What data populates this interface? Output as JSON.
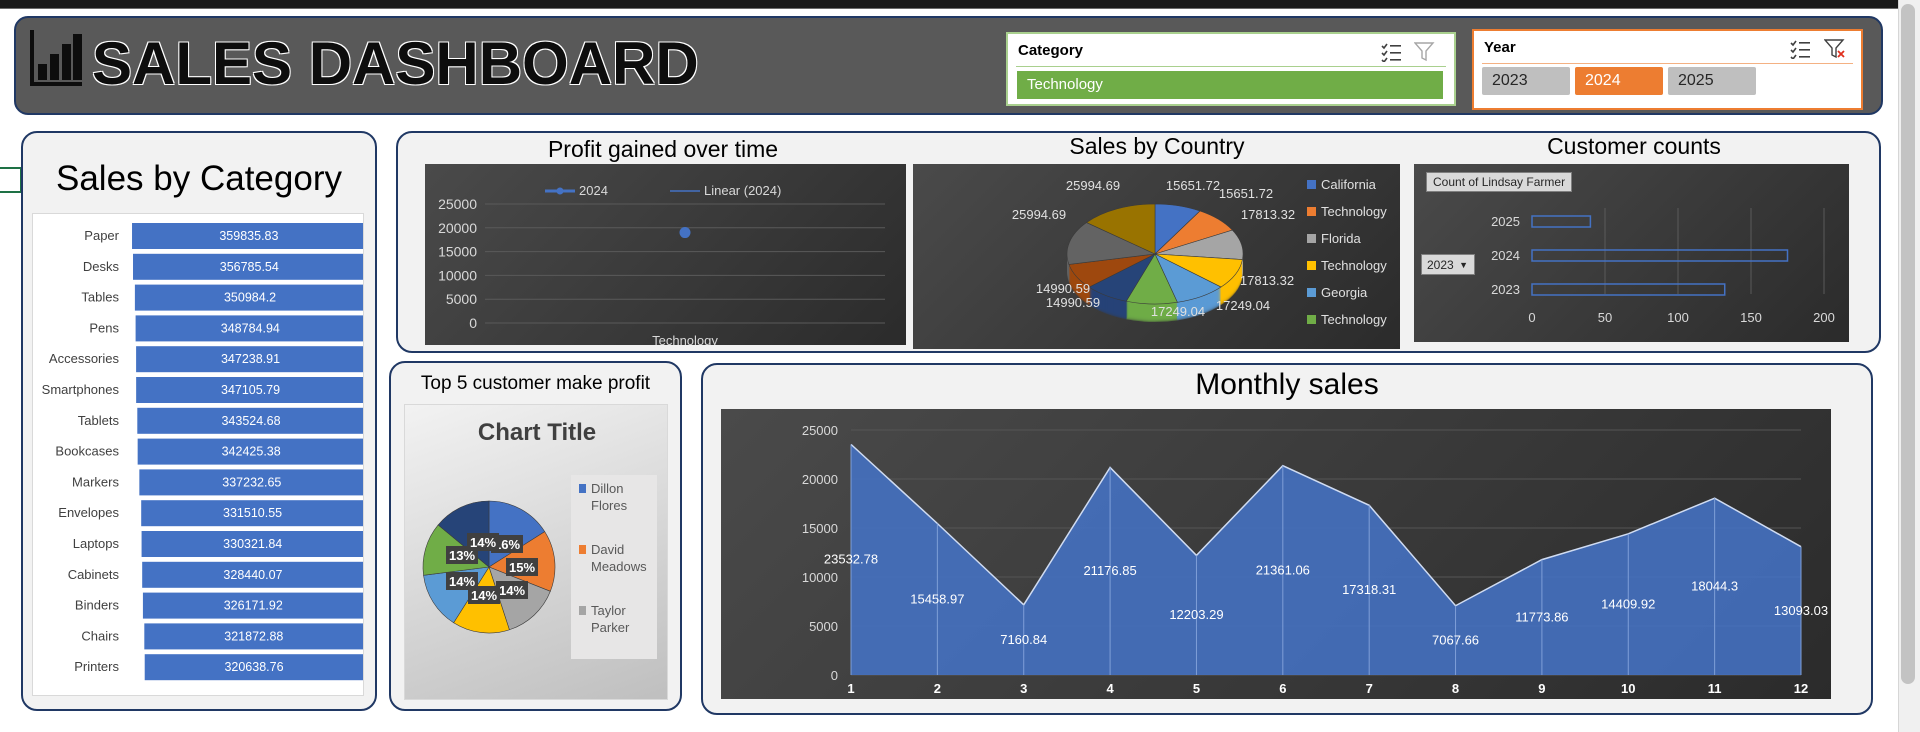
{
  "header": {
    "title": "SALES DASHBOARD"
  },
  "category_slicer": {
    "title": "Category",
    "selected": "Technology"
  },
  "year_slicer": {
    "title": "Year",
    "options": [
      "2023",
      "2024",
      "2025"
    ],
    "selected": "2024"
  },
  "sales_by_category": {
    "title": "Sales by Category",
    "chart_data": {
      "type": "bar",
      "categories": [
        "Paper",
        "Desks",
        "Tables",
        "Pens",
        "Accessories",
        "Smartphones",
        "Tablets",
        "Bookcases",
        "Markers",
        "Envelopes",
        "Laptops",
        "Cabinets",
        "Binders",
        "Chairs",
        "Printers"
      ],
      "values": [
        359835.83,
        356785.54,
        350984.2,
        348784.94,
        347238.91,
        347105.79,
        343524.68,
        342425.38,
        337232.65,
        331510.55,
        330321.84,
        328440.07,
        326171.92,
        321872.88,
        320638.76
      ],
      "labels": [
        "359835.83",
        "356785.54",
        "350984.2",
        "348784.94",
        "347238.91",
        "347105.79",
        "343524.68",
        "342425.38",
        "337232.65",
        "331510.55",
        "330321.84",
        "328440.07",
        "326171.92",
        "321872.88",
        "320638.76"
      ],
      "color": "#4472c4"
    }
  },
  "profit_over_time": {
    "title": "Profit gained over time",
    "chart_data": {
      "type": "line",
      "categories": [
        "Technology"
      ],
      "series": [
        {
          "name": "2024",
          "values": [
            19000
          ]
        },
        {
          "name": "Linear (2024)",
          "values": []
        }
      ],
      "ylim": [
        0,
        25000
      ],
      "yticks": [
        "25000",
        "20000",
        "15000",
        "10000",
        "5000",
        "0"
      ],
      "color": "#4472c4"
    }
  },
  "sales_by_country": {
    "title": "Sales by Country",
    "chart_data": {
      "type": "pie",
      "legend": [
        "California",
        "Technology",
        "Florida",
        "Technology",
        "Georgia",
        "Technology"
      ],
      "legend_colors": [
        "#4472c4",
        "#ed7d31",
        "#a5a5a5",
        "#ffc000",
        "#5b9bd5",
        "#70ad47"
      ],
      "labels": [
        "15651.72",
        "15651.72",
        "17813.32",
        "17813.32",
        "17249.04",
        "17249.04",
        "14990.59",
        "14990.59",
        "25994.69",
        "25994.69"
      ],
      "values": [
        15651.72,
        15651.72,
        17813.32,
        17813.32,
        17249.04,
        17249.04,
        14990.59,
        14990.59,
        25994.69,
        25994.69
      ],
      "colors": [
        "#4472c4",
        "#ed7d31",
        "#a5a5a5",
        "#ffc000",
        "#5b9bd5",
        "#70ad47",
        "#264478",
        "#9e480e",
        "#636363",
        "#997300"
      ]
    }
  },
  "customer_counts": {
    "title": "Customer counts",
    "field_button": "Count of Lindsay Farmer",
    "filter_value": "2023",
    "chart_data": {
      "type": "bar",
      "categories": [
        "2025",
        "2024",
        "2023"
      ],
      "values": [
        40,
        175,
        132
      ],
      "xlim": [
        0,
        200
      ],
      "xticks": [
        "0",
        "50",
        "100",
        "150",
        "200"
      ],
      "color": "#4472c4"
    }
  },
  "top5": {
    "title": "Top 5 customer make profit",
    "chart_title": "Chart Title",
    "chart_data": {
      "type": "pie",
      "legend": [
        "Dillon Flores",
        "David Meadows",
        "Taylor Parker"
      ],
      "legend_colors": [
        "#4472c4",
        "#ed7d31",
        "#a5a5a5"
      ],
      "labels": [
        "16%",
        "15%",
        "14%",
        "14%",
        "14%",
        "13%",
        "14%"
      ],
      "values": [
        16,
        15,
        14,
        14,
        14,
        13,
        14
      ],
      "colors": [
        "#4472c4",
        "#ed7d31",
        "#a5a5a5",
        "#ffc000",
        "#5b9bd5",
        "#70ad47",
        "#264478"
      ]
    }
  },
  "monthly_sales": {
    "title": "Monthly sales",
    "chart_data": {
      "type": "area",
      "x": [
        "1",
        "2",
        "3",
        "4",
        "5",
        "6",
        "7",
        "8",
        "9",
        "10",
        "11",
        "12"
      ],
      "values": [
        23532.78,
        15458.97,
        7160.84,
        21176.85,
        12203.29,
        21361.06,
        17318.31,
        7067.66,
        11773.86,
        14409.92,
        18044.3,
        13093.03
      ],
      "labels": [
        "23532.78",
        "15458.97",
        "7160.84",
        "21176.85",
        "12203.29",
        "21361.06",
        "17318.31",
        "7067.66",
        "11773.86",
        "14409.92",
        "18044.3",
        "13093.03"
      ],
      "ylim": [
        0,
        25000
      ],
      "yticks": [
        "25000",
        "20000",
        "15000",
        "10000",
        "5000",
        "0"
      ],
      "color": "#4472c4"
    }
  }
}
